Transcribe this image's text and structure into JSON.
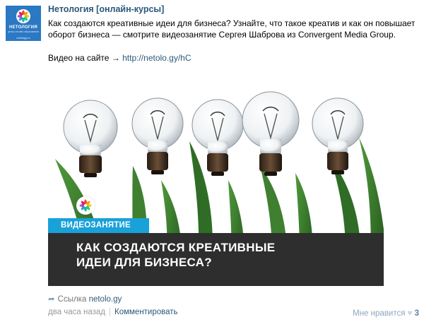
{
  "post": {
    "author": "Нетология [онлайн-курсы]",
    "text": "Как создаются креативные идеи для бизнеса? Узнайте, что такое креатив и как он повышает оборот бизнеса — смотрите видеозанятие Сергея Шаброва из Convergent Media Group.",
    "video_prefix": "Видео на сайте →",
    "video_link": "http://netolo.gy/hC"
  },
  "avatar": {
    "name": "НЕТОЛОГИЯ",
    "tagline": "центр онлайн-образования",
    "url": "netology.ru"
  },
  "attachment": {
    "band_label": "ВИДЕОЗАНЯТИЕ",
    "title_line1": "КАК СОЗДАЮТСЯ КРЕАТИВНЫЕ",
    "title_line2": "ИДЕИ ДЛЯ БИЗНЕСА?",
    "link_label": "Ссылка",
    "link_domain": "netolo.gy"
  },
  "footer": {
    "time": "два часа назад",
    "comment": "Комментировать",
    "like_label": "Мне нравится",
    "like_count": "3"
  },
  "colors": {
    "link": "#2b587a",
    "accent_band": "#19a1d9",
    "avatar_bg": "#2b78c3"
  }
}
